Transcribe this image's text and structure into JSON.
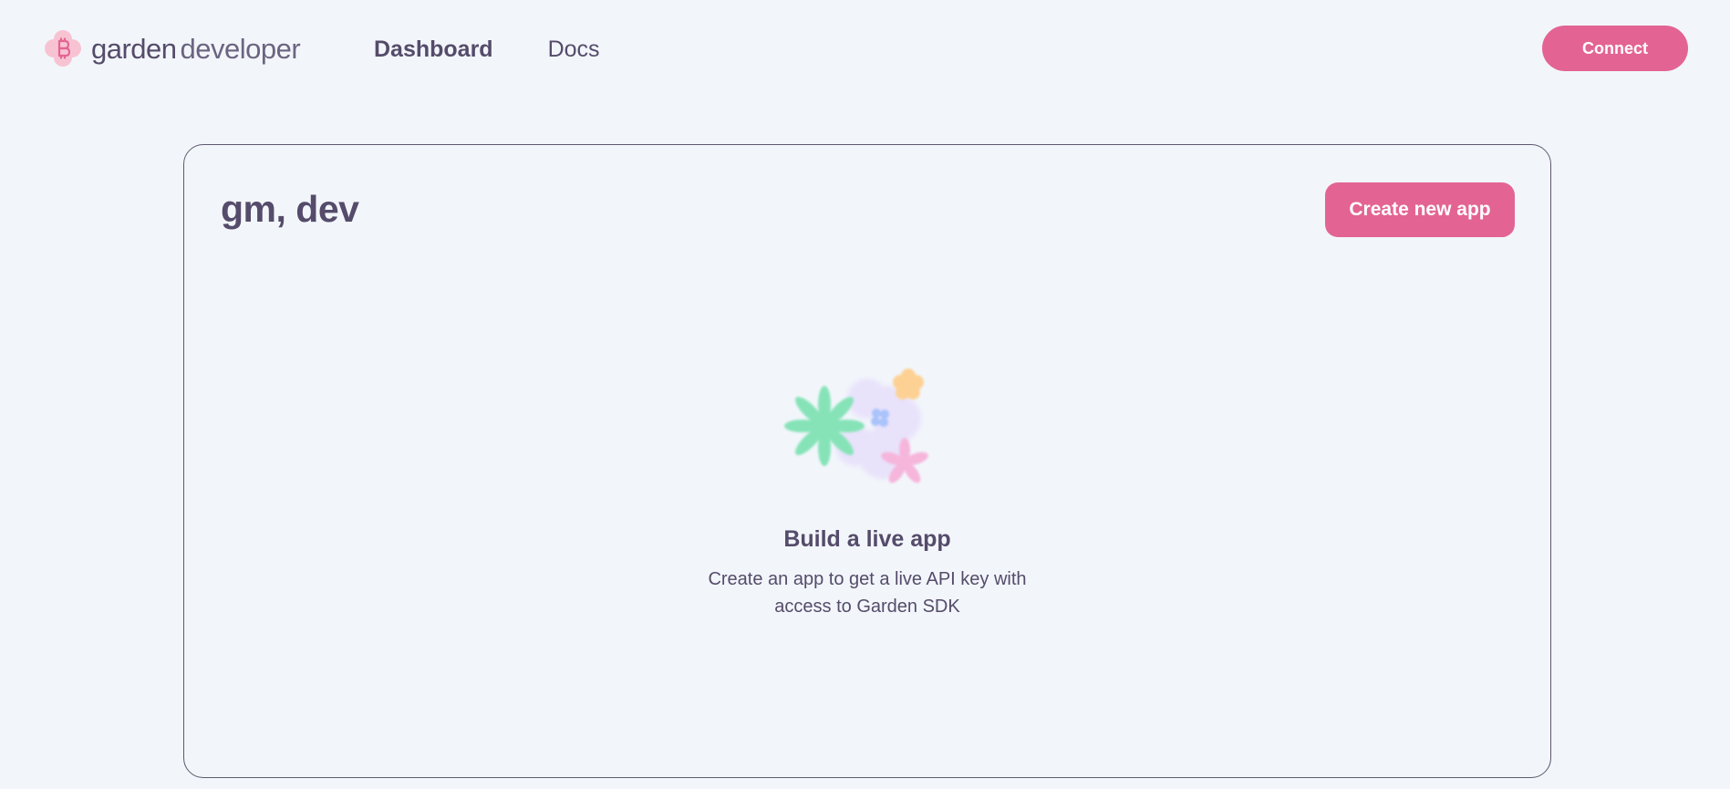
{
  "header": {
    "brand_primary": "garden",
    "brand_secondary": "developer",
    "nav": [
      {
        "label": "Dashboard",
        "active": true
      },
      {
        "label": "Docs",
        "active": false
      }
    ],
    "connect_label": "Connect"
  },
  "main": {
    "greeting": "gm, dev",
    "create_button_label": "Create new app",
    "empty_state": {
      "title": "Build a live app",
      "description": "Create an app to get a live API key with access to Garden SDK",
      "illustration": "flowers-illustration"
    }
  },
  "colors": {
    "background": "#f2f6fb",
    "accent": "#e36492",
    "text": "#554b6a",
    "border": "#5e586e"
  },
  "icons": {
    "logo": "bitcoin-flower-logo-icon"
  }
}
